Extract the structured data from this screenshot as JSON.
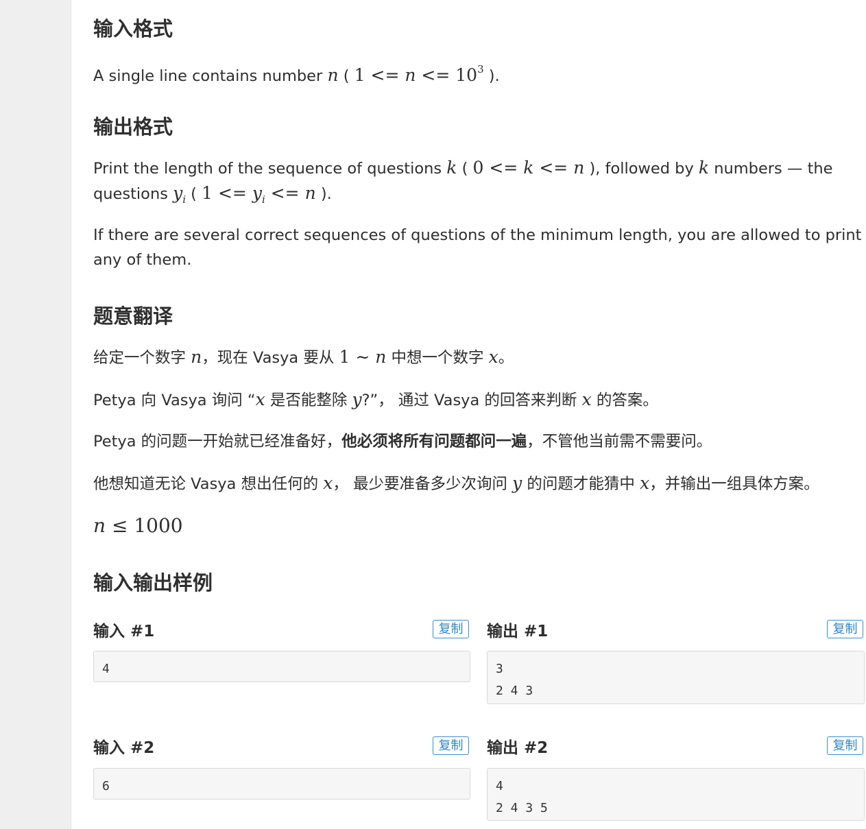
{
  "sections": {
    "input_format": {
      "title": "输入格式",
      "line1_prefix": "A single line contains number ",
      "var_n": "n",
      "paren_open": " ( ",
      "one": "1",
      "le1": " <= ",
      "n": "n",
      "le2": " <= ",
      "ten": "10",
      "exp": "3",
      "paren_close": " )."
    },
    "output_format": {
      "title": "输出格式",
      "l1_a": "Print the length of the sequence of questions ",
      "k1": "k",
      "l1_b": " ( ",
      "zero": "0",
      "le_a": " <= ",
      "k2": "k",
      "le_b": " <= ",
      "n1": "n",
      "l1_c": " ), followed by ",
      "k3": "k",
      "l1_d": " numbers — the",
      "l2_a": "questions ",
      "y1": "y",
      "i1": "i",
      "l2_b": " ( ",
      "one": "1",
      "le_c": " <= ",
      "y2": "y",
      "i2": "i",
      "le_d": " <= ",
      "n2": "n",
      "l2_c": " ).",
      "para2_line1": "If there are several correct sequences of questions of the minimum length, you are allowed to print",
      "para2_line2": "any of them."
    },
    "translation": {
      "title": "题意翻译",
      "p1_a": "给定一个数字 ",
      "p1_n": "n",
      "p1_b": "，现在 Vasya 要从 ",
      "p1_one": "1",
      "p1_tilde": " ∼ ",
      "p1_n2": "n",
      "p1_c": " 中想一个数字 ",
      "p1_x": "x",
      "p1_d": "。",
      "p2_a": "Petya 向 Vasya 询问 “",
      "p2_x": "x",
      "p2_b": " 是否能整除 ",
      "p2_y": "y",
      "p2_c": "?”， 通过 Vasya 的回答来判断 ",
      "p2_x2": "x",
      "p2_d": " 的答案。",
      "p3_a": "Petya 的问题一开始就已经准备好，",
      "p3_bold": "他必须将所有问题都问一遍",
      "p3_b": "，不管他当前需不需要问。",
      "p4_a": "他想知道无论 Vasya 想出任何的 ",
      "p4_x": "x",
      "p4_b": "， 最少要准备多少次询问 ",
      "p4_y": "y",
      "p4_c": " 的问题才能猜中 ",
      "p4_x2": "x",
      "p4_d": "，并输出一组具体方案。",
      "p5_n": "n",
      "p5_le": " ≤ ",
      "p5_val": "1000"
    },
    "samples": {
      "title": "输入输出样例",
      "copy_label": "复制",
      "items": [
        {
          "input_title": "输入 #1",
          "input": "4",
          "output_title": "输出 #1",
          "output": "3\n2 4 3"
        },
        {
          "input_title": "输入 #2",
          "input": "6",
          "output_title": "输出 #2",
          "output": "4\n2 4 3 5"
        }
      ]
    }
  }
}
